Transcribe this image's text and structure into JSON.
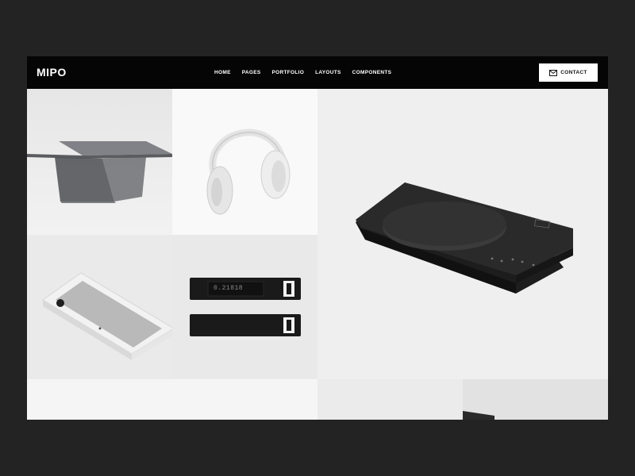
{
  "header": {
    "logo": "MIPO",
    "nav": [
      "HOME",
      "PAGES",
      "PORTFOLIO",
      "LAYOUTS",
      "COMPONENTS"
    ],
    "contact_label": "CONTACT"
  },
  "gallery": {
    "items": [
      {
        "icon": "glass-table-image"
      },
      {
        "icon": "headphones-image"
      },
      {
        "icon": "scale-device-image"
      },
      {
        "icon": "speaker-device-image"
      },
      {
        "icon": "usb-key-image",
        "display_value": "0.21818"
      }
    ]
  },
  "colors": {
    "page_background": "#232323",
    "header_background": "#050505",
    "header_text": "#ffffff",
    "button_background": "#ffffff"
  }
}
